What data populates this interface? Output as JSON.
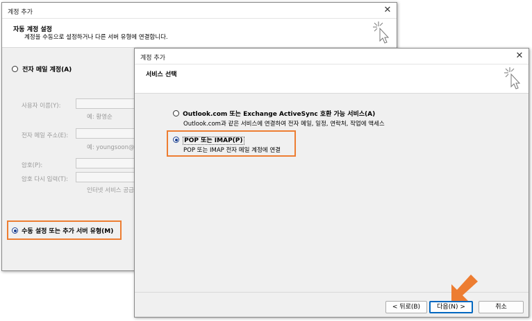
{
  "back_window": {
    "title": "계정 추가",
    "header_title": "자동 계정 설정",
    "header_subtitle": "계정을 수동으로 설정하거나 다른 서버 유형에 연결합니다.",
    "option_email_account": "전자 메일 계정(A)",
    "fields": {
      "name_label": "사용자 이름(Y):",
      "name_hint": "예: 황영순",
      "email_label": "전자 메일 주소(E):",
      "email_hint": "예: youngsoon@co",
      "password_label": "암호(P):",
      "password_retype_label": "암호 다시 입력(T):",
      "password_hint": "인터넷 서비스 공급"
    },
    "option_manual": "수동 설정 또는 추가 서버 유형(M)"
  },
  "front_window": {
    "title": "계정 추가",
    "header_title": "서비스 선택",
    "option_outlook": "Outlook.com 또는 Exchange ActiveSync 호환 가능 서비스(A)",
    "option_outlook_desc": "Outlook.com과 같은 서비스에 연결하여 전자 메일, 일정, 연락처, 작업에 액세스",
    "option_pop": "POP 또는 IMAP(P)",
    "option_pop_desc": "POP 또는 IMAP 전자 메일 계정에 연결",
    "buttons": {
      "back": "< 뒤로(B)",
      "next": "다음(N) >",
      "cancel": "취소"
    }
  },
  "colors": {
    "highlight": "#ed7d31",
    "selection": "#1a3f8f",
    "default_button_border": "#0067c0"
  },
  "icons": [
    "close-icon",
    "wizard-cursor-icon",
    "arrow-pointer-icon"
  ]
}
